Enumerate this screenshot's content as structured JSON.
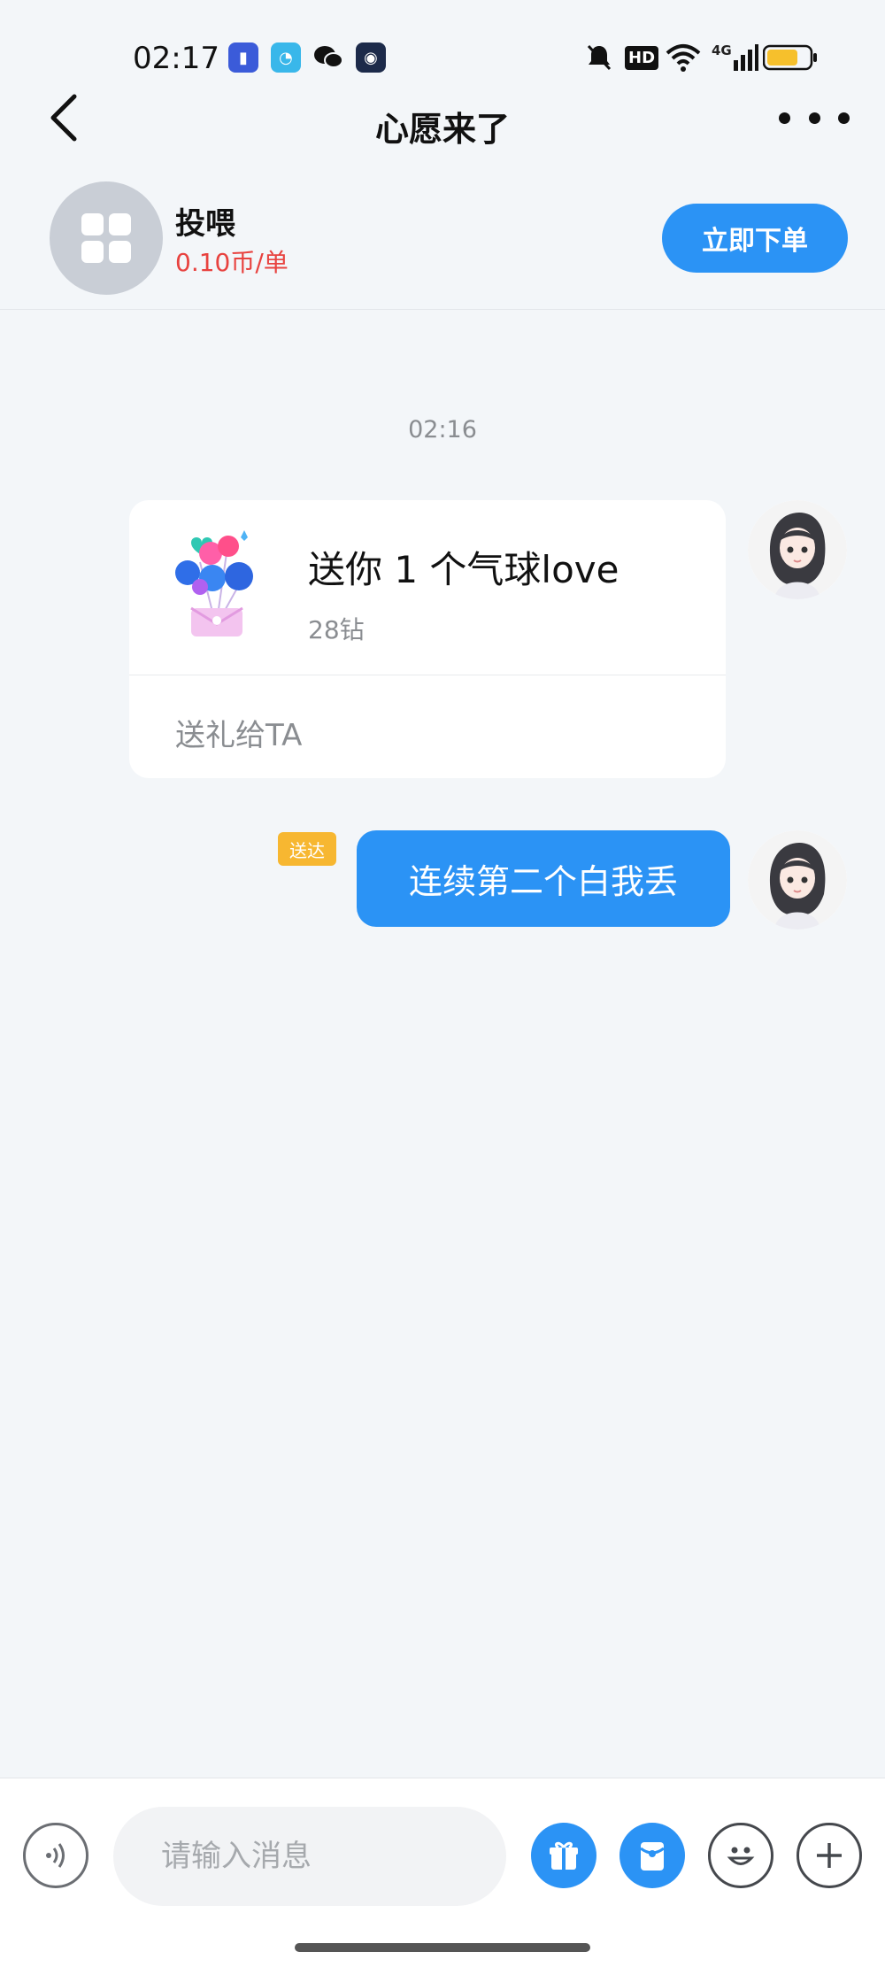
{
  "status_bar": {
    "time": "02:17",
    "hd_label": "HD",
    "network_label": "4G",
    "battery_color": "#f6c02c"
  },
  "nav": {
    "title": "心愿来了"
  },
  "service": {
    "name": "投喂",
    "price": "0.10币/单",
    "order_button": "立即下单"
  },
  "chat": {
    "timestamp": "02:16",
    "gift_card": {
      "title": "送你 1 个气球love",
      "price": "28钻",
      "action": "送礼给TA"
    },
    "message": {
      "status_badge": "送达",
      "text": "连续第二个白我丢"
    }
  },
  "input_bar": {
    "placeholder": "请输入消息"
  },
  "colors": {
    "accent": "#2b93f5",
    "price_red": "#e8423f",
    "badge_yellow": "#f7b731"
  }
}
